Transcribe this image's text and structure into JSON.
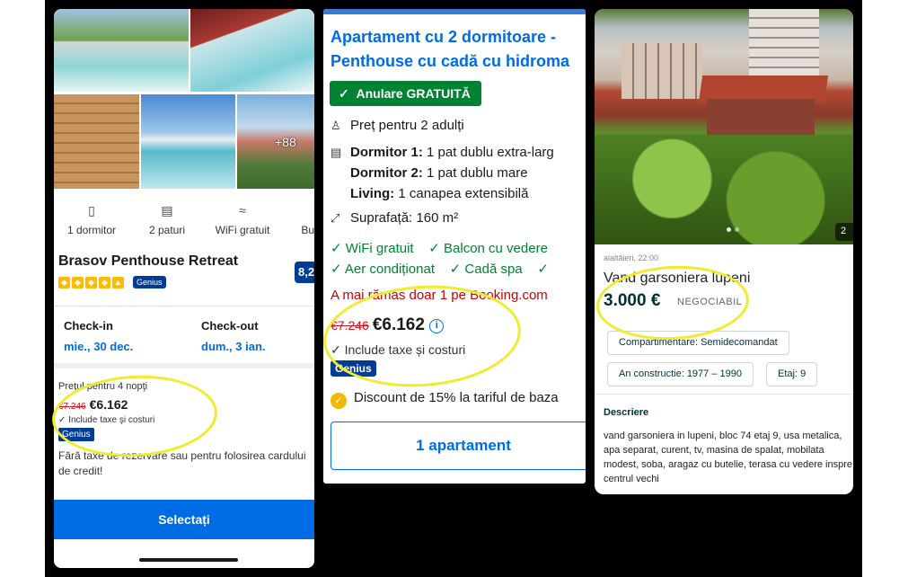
{
  "panel1": {
    "photo_more": "+88",
    "amenities": [
      {
        "icon": "door-icon",
        "label": "1 dormitor"
      },
      {
        "icon": "bed-icon",
        "label": "2 paturi"
      },
      {
        "icon": "wifi-icon",
        "label": "WiFi gratuit"
      },
      {
        "icon": "kitchen-icon",
        "label": "Bucătă"
      }
    ],
    "title": "Brasov Penthouse Retreat",
    "score": "8,2",
    "genius_badge": "Genius",
    "checkin_label": "Check-in",
    "checkin_value": "mie., 30 dec.",
    "checkout_label": "Check-out",
    "checkout_value": "dum., 3 ian.",
    "price_label": "Preţul pentru 4 nopţi",
    "old_price": "€7.246",
    "price": "€6.162",
    "includes": "Include taxe şi costuri",
    "genius_tag": "Genius",
    "free_note": "Fără taxe de rezervare sau pentru folosirea cardului de credit!",
    "select_button": "Selectați"
  },
  "panel2": {
    "title_line1": "Apartament cu 2 dormitoare -",
    "title_line2": "Penthouse cu cadă cu hidroma",
    "cancel_badge": "Anulare GRATUITĂ",
    "guests": "Preț pentru 2 adulți",
    "bedroom1_label": "Dormitor 1:",
    "bedroom1_value": "1 pat dublu extra-larg",
    "bedroom2_label": "Dormitor 2:",
    "bedroom2_value": "1 pat dublu mare",
    "living_label": "Living:",
    "living_value": "1 canapea extensibilă",
    "area": "Suprafață: 160 m²",
    "features_row1": [
      "WiFi gratuit",
      "Balcon cu vedere"
    ],
    "features_row2": [
      "Aer condiționat",
      "Cadă spa"
    ],
    "scarcity": "A mai rămas doar 1 pe Booking.com",
    "old_price": "€7.246",
    "price": "€6.162",
    "info_icon": "i",
    "includes": "Include taxe și costuri",
    "genius_tag": "Genius",
    "discount": "Discount de 15% la tariful de baza",
    "apt_button": "1 apartament"
  },
  "panel3": {
    "photo_count": "2",
    "date": "alaltăieri, 22:00",
    "title": "Vand garsoniera lupeni",
    "price": "3.000 €",
    "negotiable": "NEGOCIABIL",
    "chip_compartimentare": "Compartimentare: Semidecomandat",
    "chip_an": "An constructie: 1977 – 1990",
    "chip_etaj": "Etaj: 9",
    "description_heading": "Descriere",
    "description": "vand garsoniera in lupeni, bloc 74 etaj 9, usa metalica, apa separat, curent, tv, masina de spalat, mobilata modest, soba, aragaz cu butelie, terasa cu vedere inspre centrul vechi"
  },
  "colors": {
    "booking_blue": "#006ce4",
    "booking_dark_blue": "#003b95",
    "green": "#008234",
    "highlight_yellow": "#f2ea2e",
    "olx_dark": "#002f34"
  }
}
